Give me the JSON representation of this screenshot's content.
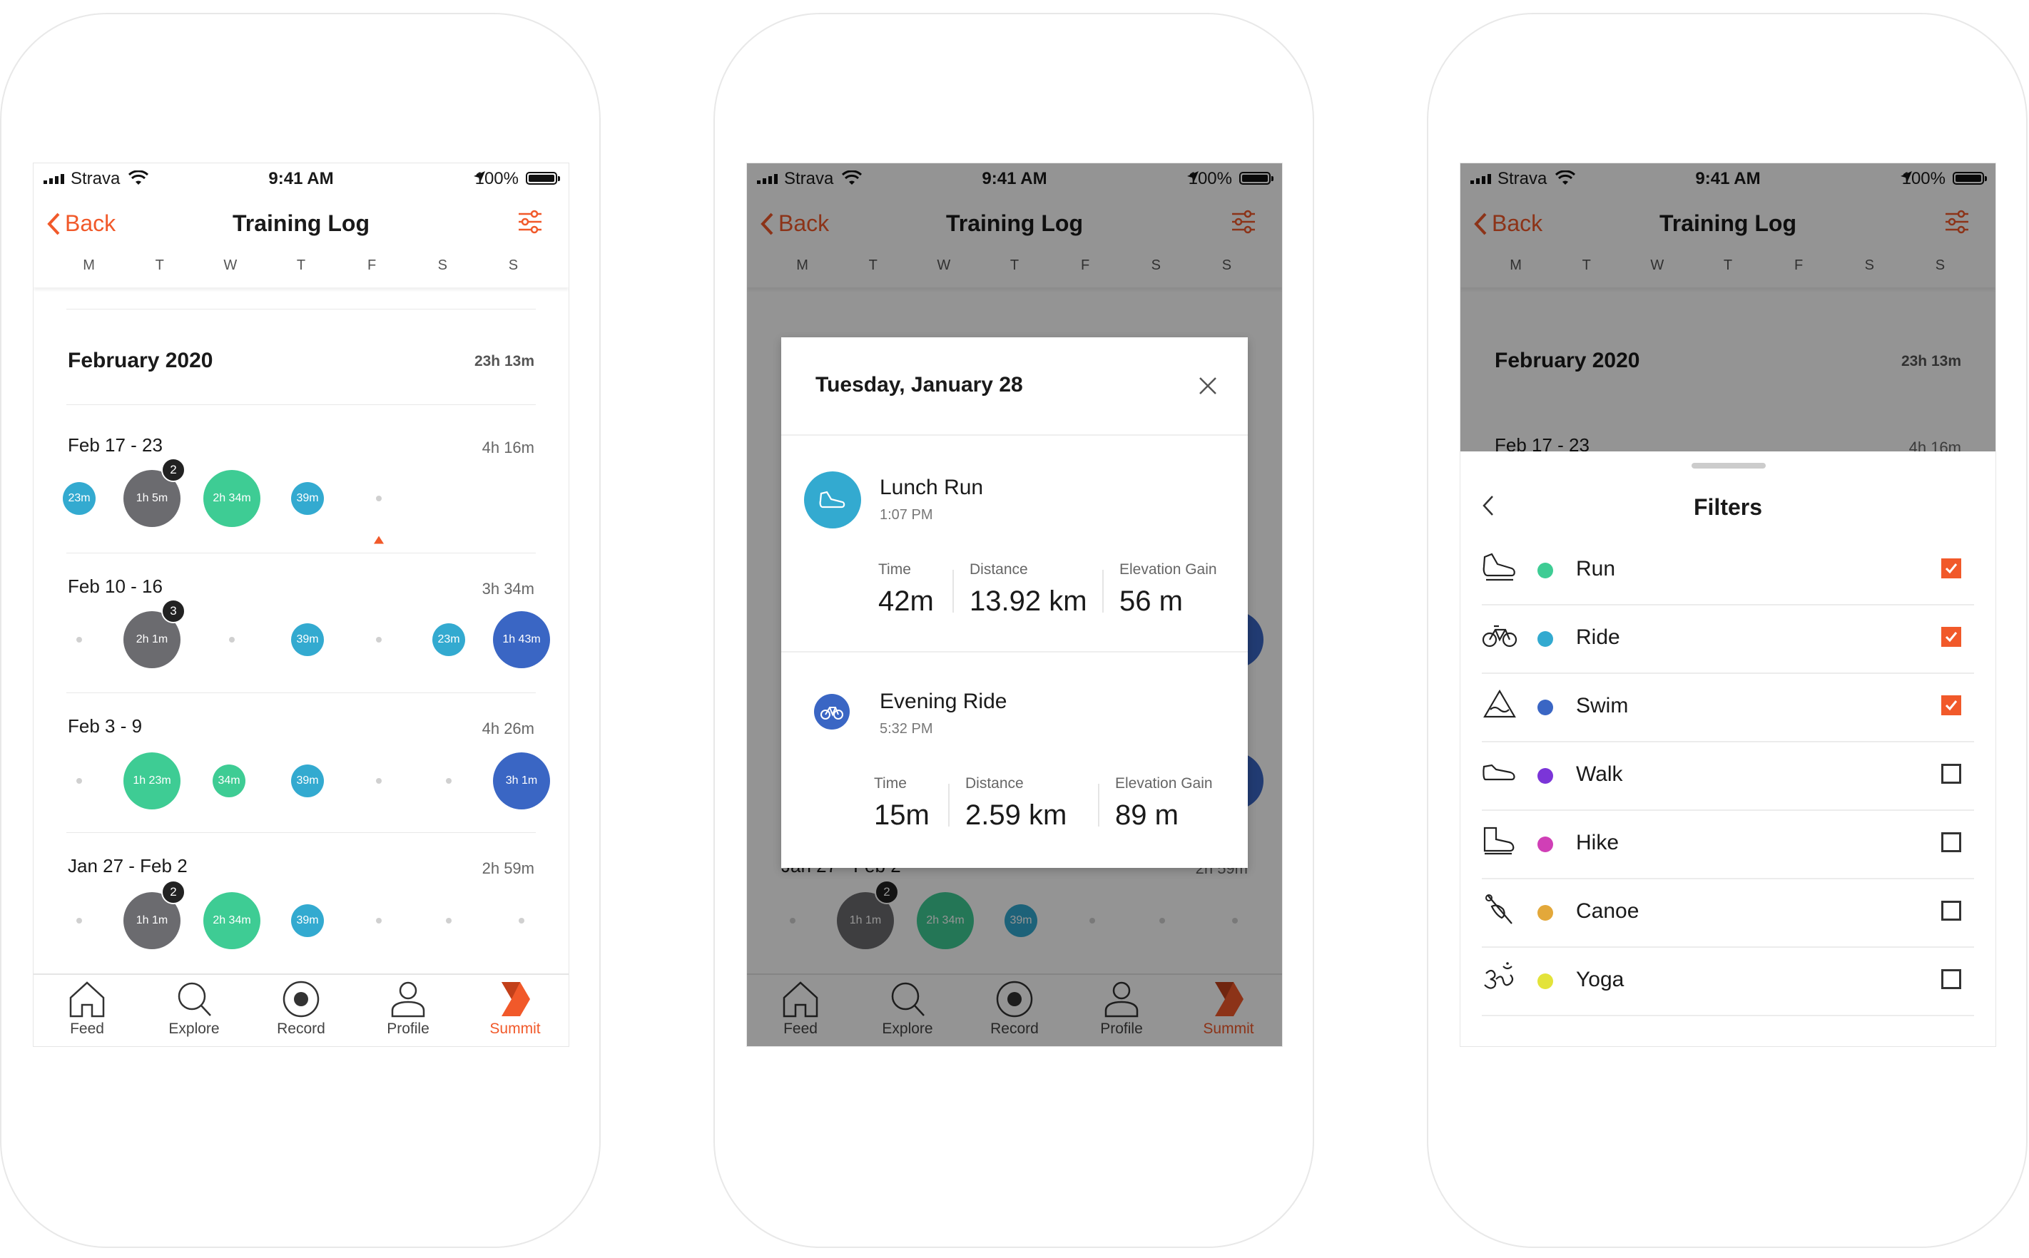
{
  "status": {
    "carrier": "Strava",
    "time": "9:41 AM",
    "battery": "100%"
  },
  "nav": {
    "back_label": "Back",
    "title": "Training Log"
  },
  "days": [
    "M",
    "T",
    "W",
    "T",
    "F",
    "S",
    "S"
  ],
  "month": {
    "label": "February 2020",
    "total": "23h 13m"
  },
  "weeks": [
    {
      "label": "Feb 17 - 23",
      "total": "4h 16m",
      "b": [
        "23m",
        "1h 5m",
        "2h 34m",
        "39m"
      ],
      "count": "2"
    },
    {
      "label": "Feb 10 - 16",
      "total": "3h 34m",
      "b": [
        "2h 1m",
        "39m",
        "23m",
        "1h 43m"
      ],
      "count": "3"
    },
    {
      "label": "Feb 3 - 9",
      "total": "4h 26m",
      "b": [
        "1h 23m",
        "34m",
        "39m",
        "3h 1m"
      ]
    },
    {
      "label": "Jan 27 - Feb 2",
      "total": "2h 59m",
      "b": [
        "1h 1m",
        "2h 34m",
        "39m"
      ],
      "count": "2"
    }
  ],
  "tabs": [
    "Feed",
    "Explore",
    "Record",
    "Profile",
    "Summit"
  ],
  "modal": {
    "title": "Tuesday, January 28",
    "activities": [
      {
        "name": "Lunch Run",
        "time": "1:07 PM",
        "stats": [
          {
            "label": "Time",
            "value": "42m"
          },
          {
            "label": "Distance",
            "value": "13.92 km"
          },
          {
            "label": "Elevation Gain",
            "value": "56 m"
          }
        ]
      },
      {
        "name": "Evening Ride",
        "time": "5:32 PM",
        "stats": [
          {
            "label": "Time",
            "value": "15m"
          },
          {
            "label": "Distance",
            "value": "2.59 km"
          },
          {
            "label": "Elevation Gain",
            "value": "89 m"
          }
        ]
      }
    ]
  },
  "filters": {
    "title": "Filters",
    "items": [
      {
        "label": "Run",
        "checked": true,
        "color": "#3ecc94",
        "icon": "running-shoe-icon"
      },
      {
        "label": "Ride",
        "checked": true,
        "color": "#33aad0",
        "icon": "bicycle-icon"
      },
      {
        "label": "Swim",
        "checked": true,
        "color": "#3a66c4",
        "icon": "swim-icon"
      },
      {
        "label": "Walk",
        "checked": false,
        "color": "#7b35d8",
        "icon": "walk-shoe-icon"
      },
      {
        "label": "Hike",
        "checked": false,
        "color": "#d03fb6",
        "icon": "hiking-boot-icon"
      },
      {
        "label": "Canoe",
        "checked": false,
        "color": "#e3a83a",
        "icon": "canoe-icon"
      },
      {
        "label": "Yoga",
        "checked": false,
        "color": "#e3e33a",
        "icon": "yoga-om-icon"
      }
    ]
  },
  "colors": {
    "accent": "#f1592a",
    "run": "#3ecc94",
    "ride": "#33aad0",
    "swim": "#3a66c4",
    "multi": "#6b6b6f"
  }
}
